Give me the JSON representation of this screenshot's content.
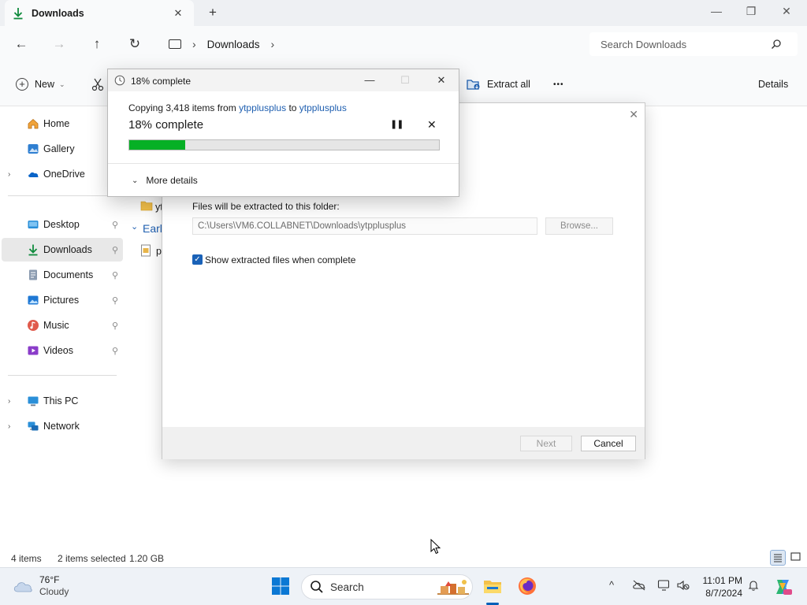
{
  "window": {
    "tab_title": "Downloads",
    "tab_close": "✕",
    "new_tab": "+",
    "minimize": "—",
    "maximize": "❐",
    "close": "✕"
  },
  "address": {
    "back": "←",
    "forward": "→",
    "up": "↑",
    "refresh": "↻",
    "crumb_sep": "›",
    "crumb": "Downloads",
    "crumb_trailing": "›",
    "search_placeholder": "Search Downloads"
  },
  "commands": {
    "new_label": "New",
    "new_caret": "⌄",
    "extract_all": "Extract all",
    "more": "•••",
    "details": "Details"
  },
  "sidebar": {
    "items": [
      {
        "label": "Home",
        "icon": "home-icon"
      },
      {
        "label": "Gallery",
        "icon": "gallery-icon"
      },
      {
        "label": "OneDrive",
        "icon": "onedrive-icon"
      },
      {
        "label": "Desktop",
        "icon": "desktop-icon"
      },
      {
        "label": "Downloads",
        "icon": "downloads-icon"
      },
      {
        "label": "Documents",
        "icon": "documents-icon"
      },
      {
        "label": "Pictures",
        "icon": "pictures-icon"
      },
      {
        "label": "Music",
        "icon": "music-icon"
      },
      {
        "label": "Videos",
        "icon": "videos-icon"
      },
      {
        "label": "This PC",
        "icon": "this-pc-icon"
      },
      {
        "label": "Network",
        "icon": "network-icon"
      }
    ],
    "expand_glyph": "›",
    "pin_glyph": "📌"
  },
  "content_peek": {
    "folder_fragment": "yt",
    "group_fragment": "Earl",
    "group_chevron": "⌄",
    "file_fragment": "p"
  },
  "status": {
    "item_count": "4 items",
    "selection": "2 items selected",
    "size": "1.20 GB"
  },
  "wizard": {
    "close": "✕",
    "folder_label": "Files will be extracted to this folder:",
    "path_value": "C:\\Users\\VM6.COLLABNET\\Downloads\\ytpplusplus",
    "browse": "Browse...",
    "checkbox_checked": "✓",
    "checkbox_label": "Show extracted files when complete",
    "next": "Next",
    "cancel": "Cancel"
  },
  "progress": {
    "title": "18% complete",
    "minimize": "—",
    "maximize": "☐",
    "close": "✕",
    "copying_prefix": "Copying 3,418 items from ",
    "source": "ytpplusplus",
    "to_word": " to ",
    "destination": "ytpplusplus",
    "percent_text": "18% complete",
    "pause": "❚❚",
    "cancel": "✕",
    "percent_value": 18,
    "more_details": "More details",
    "more_chevron": "⌄",
    "bar_color": "#06b025"
  },
  "taskbar": {
    "temperature": "76°F",
    "condition": "Cloudy",
    "search_label": "Search",
    "time": "11:01 PM",
    "date": "8/7/2024",
    "tray_chevron": "^"
  }
}
